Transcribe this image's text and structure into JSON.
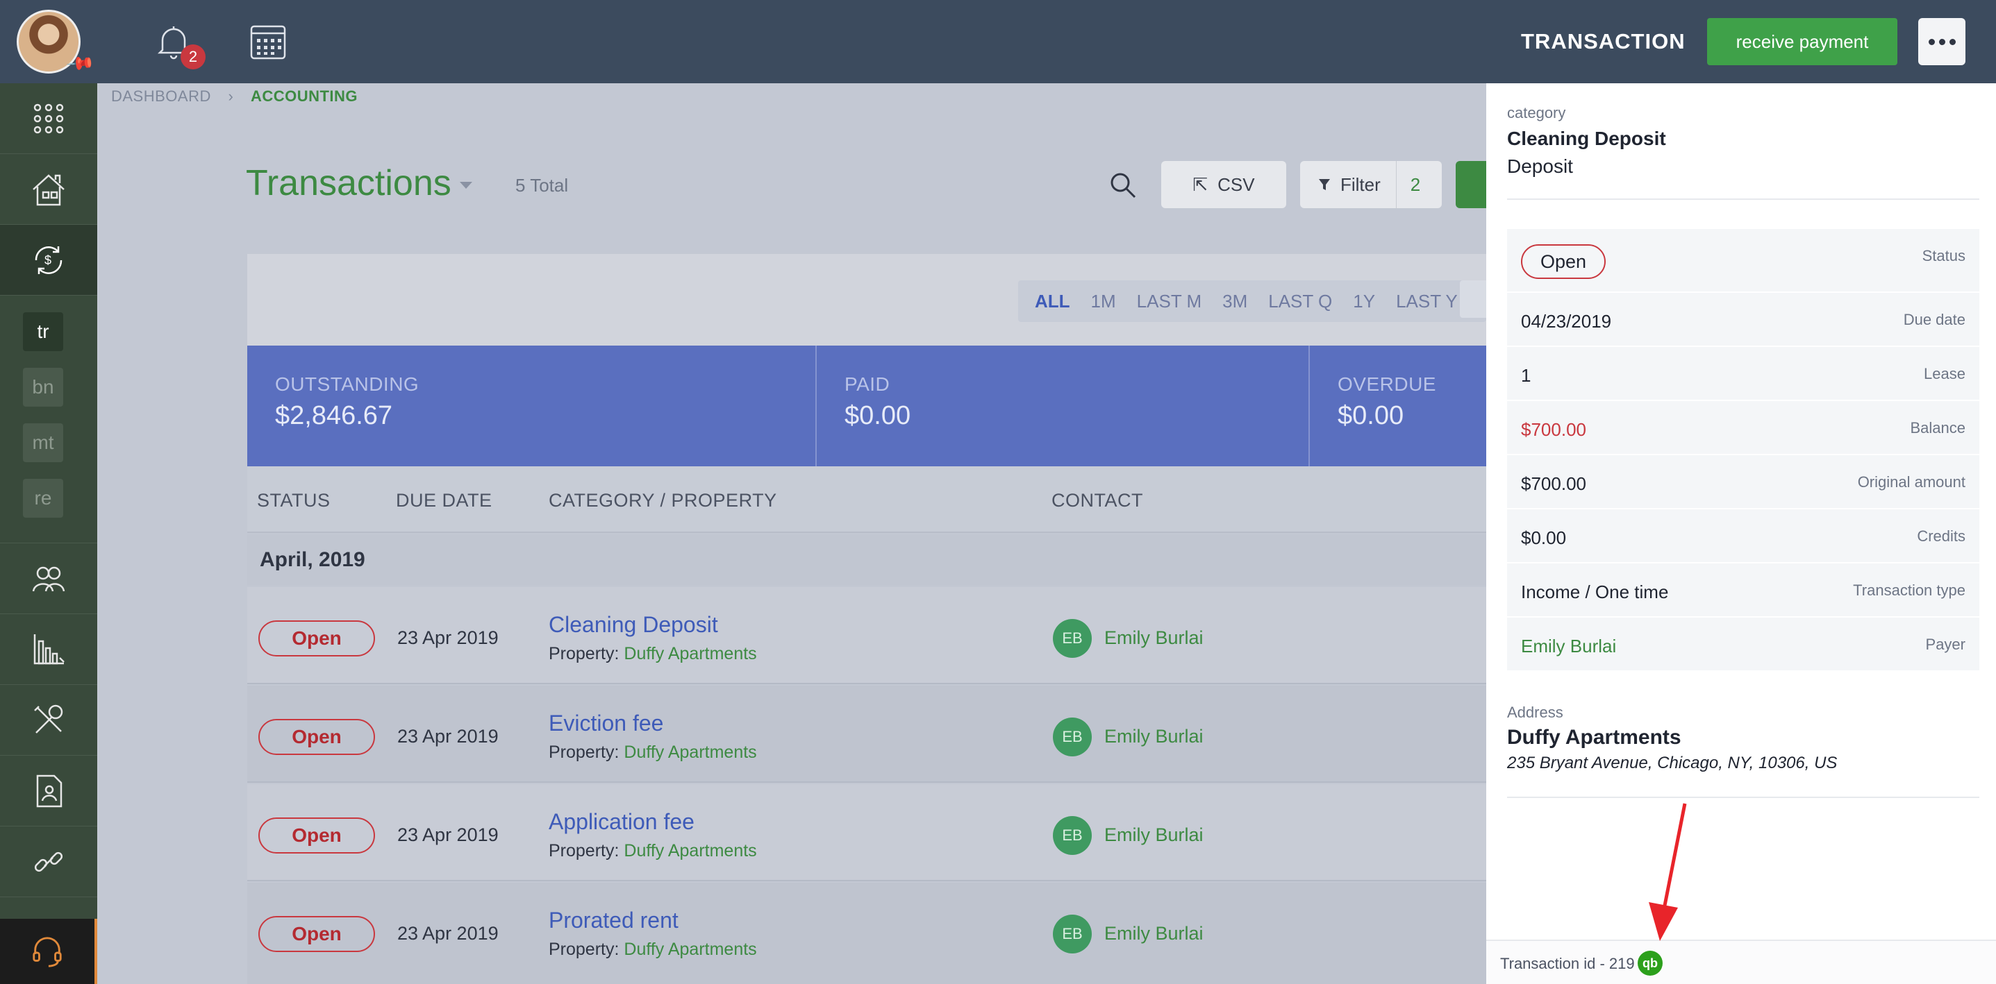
{
  "app": {
    "notifications_count": "2",
    "breadcrumb": [
      "DASHBOARD",
      "ACCOUNTING"
    ],
    "sidebar": {
      "items": [
        {
          "name": "apps-grid-icon"
        },
        {
          "name": "properties-house-icon"
        },
        {
          "name": "accounting-icon",
          "active": true
        },
        {
          "name": "people-icon"
        },
        {
          "name": "reports-chart-icon"
        },
        {
          "name": "maintenance-tools-icon"
        },
        {
          "name": "documents-icon"
        },
        {
          "name": "integrations-link-icon"
        }
      ],
      "sub_items": [
        {
          "label": "tr",
          "active": true
        },
        {
          "label": "bn"
        },
        {
          "label": "mt"
        },
        {
          "label": "re"
        }
      ],
      "support_icon": "headset-icon"
    }
  },
  "page": {
    "title": "Transactions",
    "total": "5 Total",
    "csv_label": "CSV",
    "filter_label": "Filter",
    "filter_count": "2",
    "periods": [
      "ALL",
      "1M",
      "LAST M",
      "3M",
      "LAST Q",
      "1Y",
      "LAST Y"
    ],
    "active_period": "ALL",
    "summary": [
      {
        "label": "OUTSTANDING",
        "value": "$2,846.67"
      },
      {
        "label": "PAID",
        "value": "$0.00"
      },
      {
        "label": "OVERDUE",
        "value": "$0.00"
      }
    ],
    "columns": [
      "STATUS",
      "DUE DATE",
      "CATEGORY / PROPERTY",
      "CONTACT"
    ],
    "group_label": "April, 2019",
    "property_label": "Property:",
    "rows": [
      {
        "status": "Open",
        "due": "23 Apr 2019",
        "category": "Cleaning Deposit",
        "property": "Duffy Apartments",
        "initials": "EB",
        "contact": "Emily Burlai"
      },
      {
        "status": "Open",
        "due": "23 Apr 2019",
        "category": "Eviction fee",
        "property": "Duffy Apartments",
        "initials": "EB",
        "contact": "Emily Burlai"
      },
      {
        "status": "Open",
        "due": "23 Apr 2019",
        "category": "Application fee",
        "property": "Duffy Apartments",
        "initials": "EB",
        "contact": "Emily Burlai"
      },
      {
        "status": "Open",
        "due": "23 Apr 2019",
        "category": "Prorated rent",
        "property": "Duffy Apartments",
        "initials": "EB",
        "contact": "Emily Burlai"
      }
    ]
  },
  "panel": {
    "title": "TRANSACTION",
    "receive_label": "receive payment",
    "category_label": "category",
    "category": "Cleaning Deposit",
    "category_sub": "Deposit",
    "status": "Open",
    "status_label": "Status",
    "details": [
      {
        "value": "04/23/2019",
        "key": "Due date"
      },
      {
        "value": "1",
        "key": "Lease"
      },
      {
        "value": "$700.00",
        "key": "Balance"
      },
      {
        "value": "$700.00",
        "key": "Original amount"
      },
      {
        "value": "$0.00",
        "key": "Credits"
      },
      {
        "value": "Income / One time",
        "key": "Transaction type"
      },
      {
        "value": "Emily Burlai",
        "key": "Payer"
      }
    ],
    "address_label": "Address",
    "address_name": "Duffy Apartments",
    "address_line": "235 Bryant Avenue, Chicago, NY, 10306, US",
    "transaction_id": "Transaction id - 219",
    "qb_glyph": "qb"
  },
  "colors": {
    "brand_green": "#3d8a42",
    "summary_blue": "#5a6fbf",
    "status_red": "#c9383f",
    "topbar": "#3c4b5e"
  }
}
